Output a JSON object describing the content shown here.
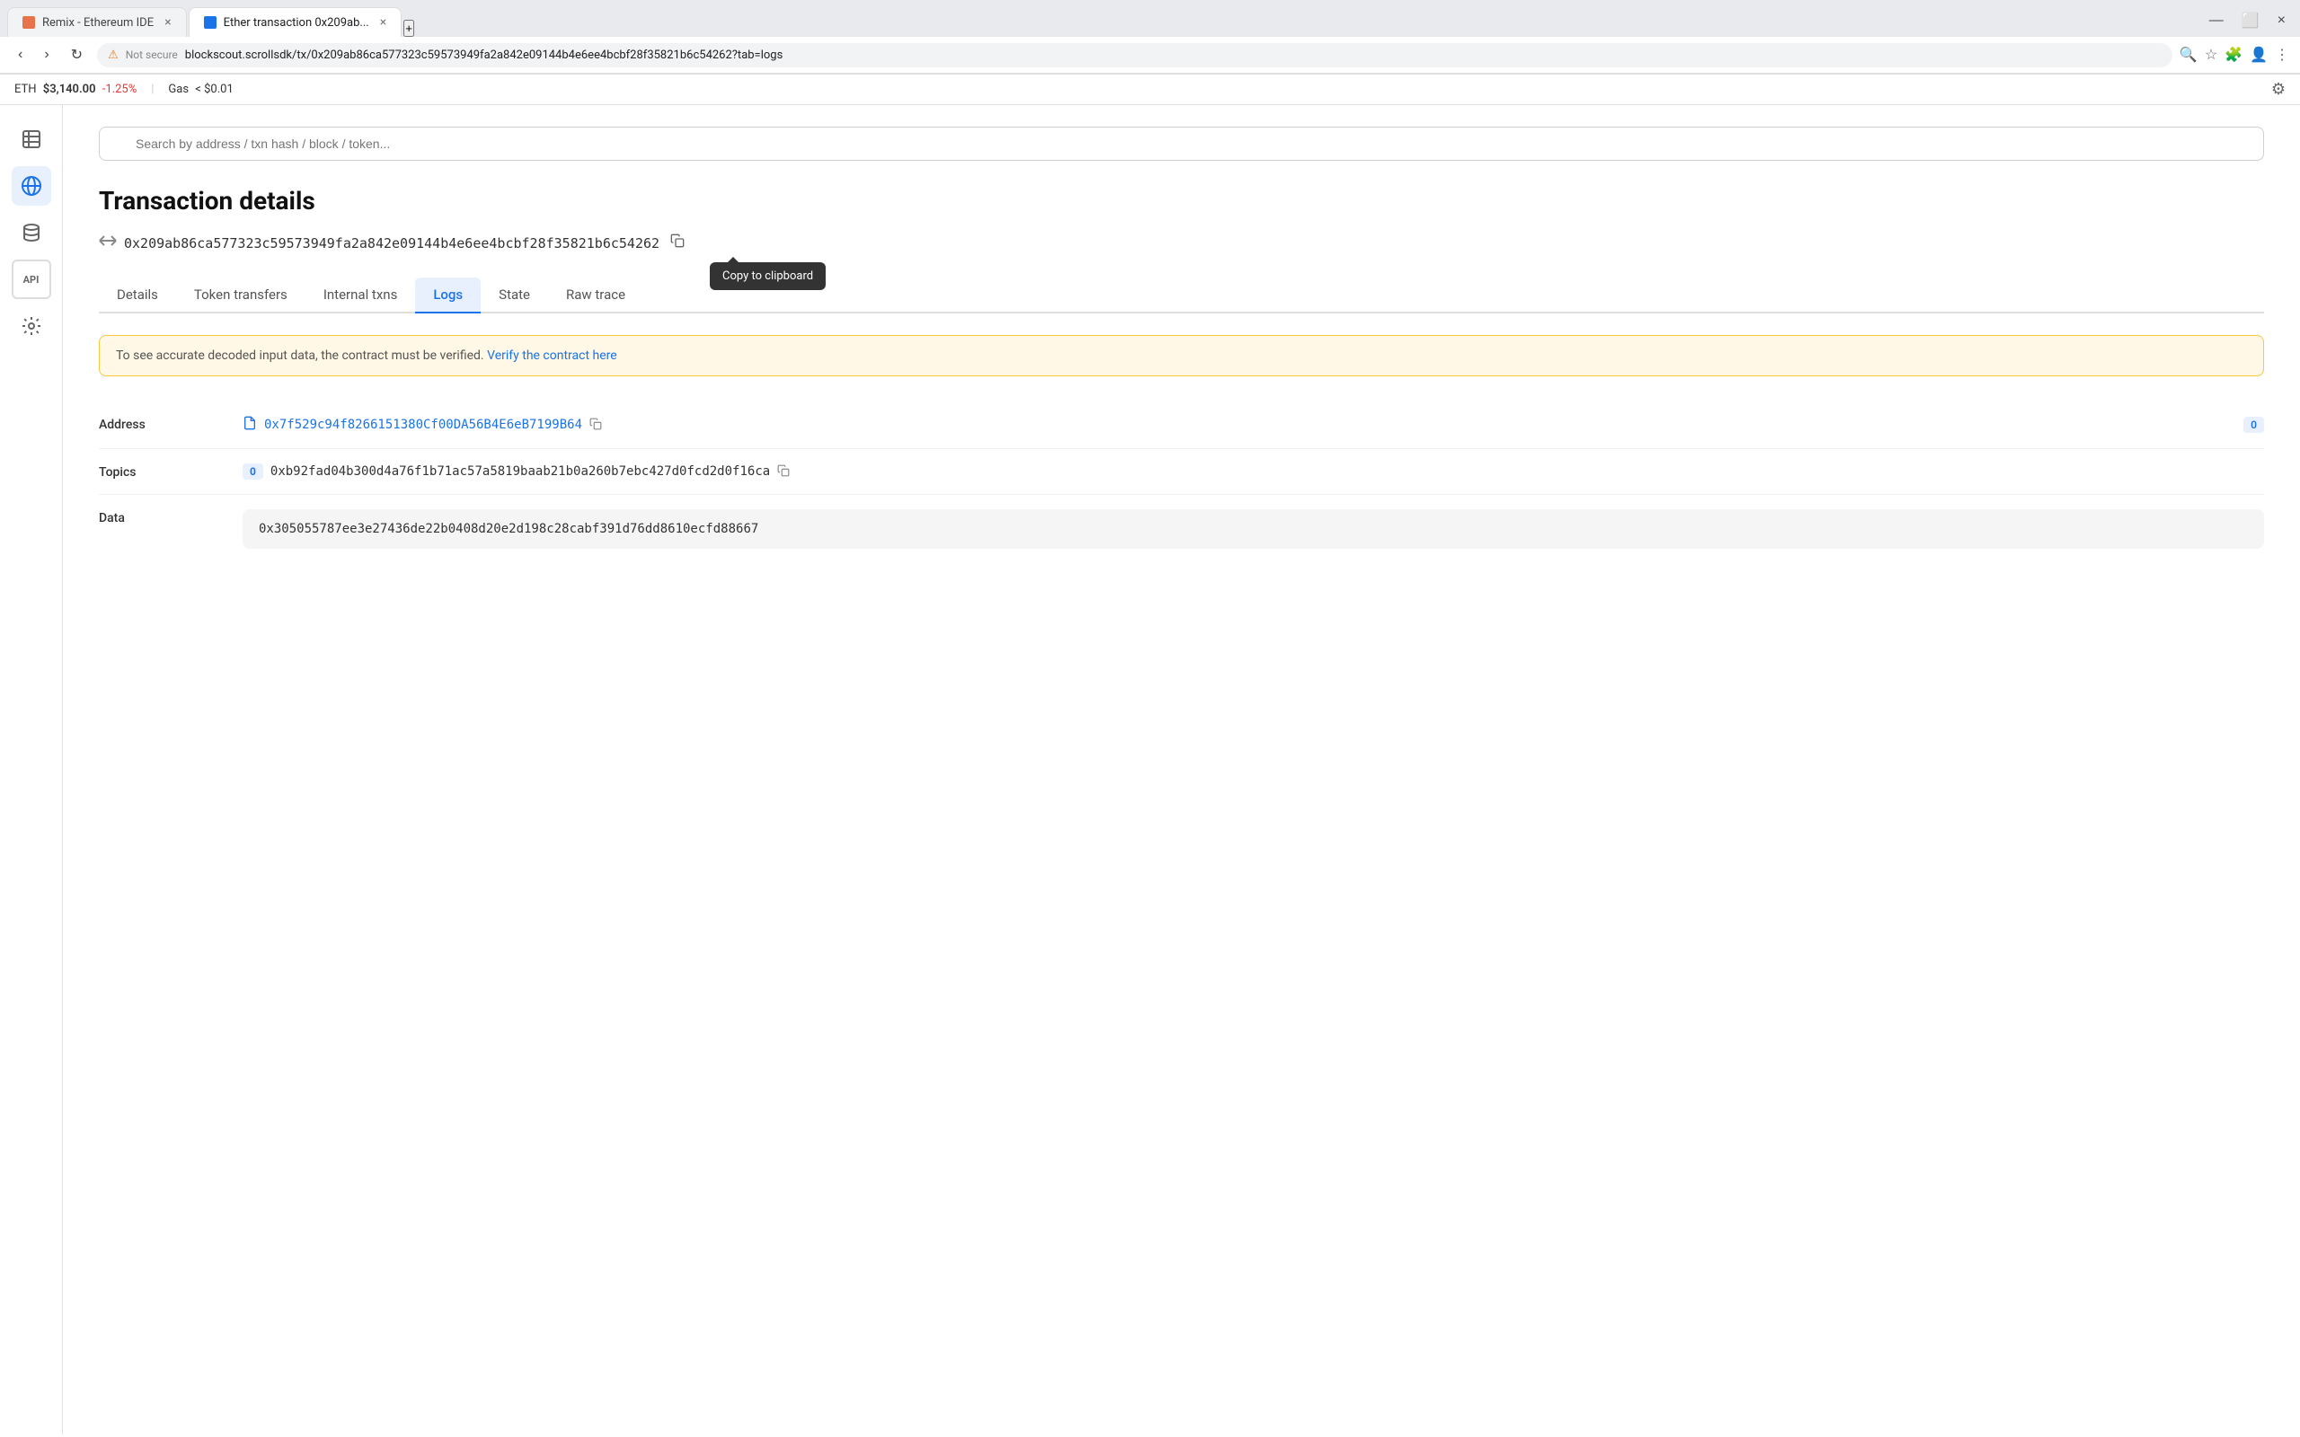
{
  "browser": {
    "tabs": [
      {
        "id": "tab1",
        "label": "Remix - Ethereum IDE",
        "favicon_color": "#e8734a",
        "active": false
      },
      {
        "id": "tab2",
        "label": "Ether transaction 0x209ab...",
        "favicon_color": "#1a73e8",
        "active": true
      }
    ],
    "url": "blockscout.scrollsdk/tx/0x209ab86ca577323c59573949fa2a842e09144b4e6ee4bcbf28f35821b6c54262?tab=logs",
    "not_secure_label": "Not secure"
  },
  "topbar": {
    "eth_label": "ETH",
    "eth_price": "$3,140.00",
    "eth_change": "-1.25%",
    "gas_label": "Gas",
    "gas_value": "< $0.01"
  },
  "sidebar": {
    "icons": [
      {
        "name": "document-icon",
        "symbol": "🗒",
        "active": false
      },
      {
        "name": "globe-icon",
        "symbol": "🌐",
        "active": true
      },
      {
        "name": "database-icon",
        "symbol": "🗄",
        "active": false
      },
      {
        "name": "api-icon",
        "symbol": "API",
        "active": false,
        "text": true
      },
      {
        "name": "settings-icon",
        "symbol": "⚙",
        "active": false
      }
    ]
  },
  "search": {
    "placeholder": "Search by address / txn hash / block / token..."
  },
  "page": {
    "title": "Transaction details",
    "tx_hash": "0x209ab86ca577323c59573949fa2a842e09144b4e6ee4bcbf28f35821b6c54262",
    "copy_tooltip": "Copy to clipboard"
  },
  "tabs": [
    {
      "id": "details",
      "label": "Details",
      "active": false
    },
    {
      "id": "token-transfers",
      "label": "Token transfers",
      "active": false
    },
    {
      "id": "internal-txns",
      "label": "Internal txns",
      "active": false
    },
    {
      "id": "logs",
      "label": "Logs",
      "active": true
    },
    {
      "id": "state",
      "label": "State",
      "active": false
    },
    {
      "id": "raw-trace",
      "label": "Raw trace",
      "active": false
    }
  ],
  "warning": {
    "message": "To see accurate decoded input data, the contract must be verified.",
    "link_text": "Verify the contract here",
    "link_href": "#"
  },
  "log_entry": {
    "address_label": "Address",
    "address_value": "0x7f529c94f8266151380Cf00DA56B4E6eB7199B64",
    "address_badge": "0",
    "topics_label": "Topics",
    "topic_index": "0",
    "topic_value": "0xb92fad04b300d4a76f1b71ac57a5819baab21b0a260b7ebc427d0fcd2d0f16ca",
    "data_label": "Data",
    "data_value": "0x305055787ee3e27436de22b0408d20e2d198c28cabf391d76dd8610ecfd88667"
  }
}
